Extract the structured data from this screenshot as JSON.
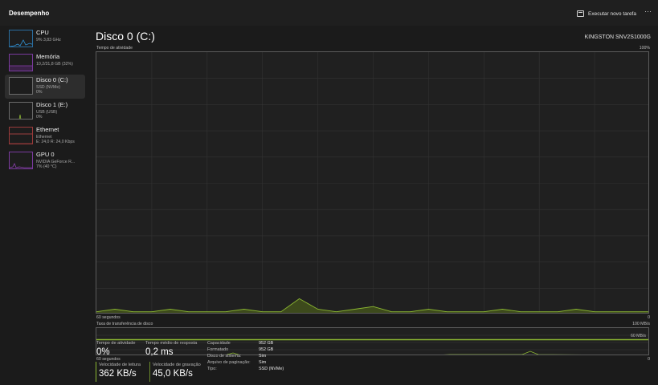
{
  "header": {
    "title": "Desempenho",
    "run_task_label": "Executar novo tarefa",
    "more_label": "···"
  },
  "sidebar": {
    "items": [
      {
        "name": "CPU",
        "sub1": "9% 3,83 GHz",
        "sub2": ""
      },
      {
        "name": "Memória",
        "sub1": "10,2/31,8 GB (32%)",
        "sub2": ""
      },
      {
        "name": "Disco 0 (C:)",
        "sub1": "SSD (NVMe)",
        "sub2": "0%"
      },
      {
        "name": "Disco 1 (E:)",
        "sub1": "USB (USB)",
        "sub2": "0%"
      },
      {
        "name": "Ethernet",
        "sub1": "Ethernet",
        "sub2": "E: 24,0 R: 24,0 Kbps"
      },
      {
        "name": "GPU 0",
        "sub1": "NVIDIA GeForce R...",
        "sub2": "7% (40 °C)"
      }
    ]
  },
  "main": {
    "title": "Disco 0 (C:)",
    "model": "KINGSTON SNV2S1000G",
    "activity_graph": {
      "label": "Tempo de atividade",
      "max_label": "100%",
      "time_label": "60 segundos",
      "min_label": "0"
    },
    "transfer_graph": {
      "label": "Taxa de transferência de disco",
      "max_label": "100 MB/s",
      "ref_label": "60 MB/s",
      "time_label": "60 segundos",
      "min_label": "0"
    },
    "stats": {
      "active_time_label": "Tempo de atividade",
      "active_time_value": "0%",
      "response_label": "Tempo médio de resposta",
      "response_value": "0,2 ms",
      "read_label": "Velocidade de leitura",
      "read_value": "362 KB/s",
      "write_label": "Velocidade de gravação",
      "write_value": "45,0 KB/s"
    },
    "properties": [
      {
        "label": "Capacidade",
        "value": "952 GB"
      },
      {
        "label": "Formatado",
        "value": "952 GB"
      },
      {
        "label": "Disco de sistema:",
        "value": "Sim"
      },
      {
        "label": "Arquivo de paginação:",
        "value": "Sim"
      },
      {
        "label": "Tipo:",
        "value": "SSD (NVMe)"
      }
    ]
  },
  "chart_data": {
    "type": "area",
    "title": "Tempo de atividade",
    "ylim": [
      0,
      100
    ],
    "x": [
      0,
      2,
      4,
      6,
      8,
      10,
      12,
      14,
      16,
      18,
      20,
      22,
      24,
      26,
      28,
      30,
      32,
      34,
      36,
      38,
      40,
      42,
      44,
      46,
      48,
      50,
      52,
      54,
      56,
      58,
      60
    ],
    "series": [
      {
        "values": [
          1,
          2,
          1,
          1,
          2,
          1,
          1,
          1,
          2,
          1,
          1,
          6,
          2,
          1,
          2,
          3,
          1,
          1,
          2,
          1,
          1,
          1,
          2,
          1,
          1,
          1,
          2,
          1,
          1,
          1,
          1
        ]
      }
    ]
  },
  "colors": {
    "disk_accent": "#8cb832",
    "cpu": "#2f8fd1",
    "memory": "#8c3fb0",
    "ethernet": "#c84a4a",
    "gpu": "#8c3fb0"
  }
}
